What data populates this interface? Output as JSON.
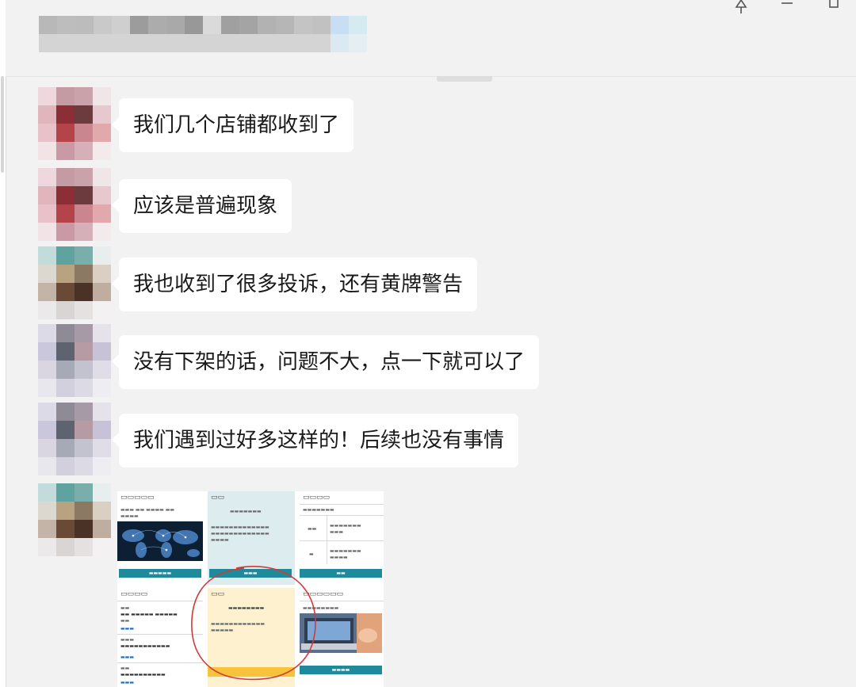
{
  "window": {
    "title": "",
    "controls": {
      "pin_icon": "pin-icon",
      "minimize_icon": "minimize-icon",
      "maximize_icon": "maximize-icon"
    }
  },
  "messages": [
    {
      "avatar": "avatar-red",
      "text": "我们几个店铺都收到了"
    },
    {
      "avatar": "avatar-red",
      "text": "应该是普遍现象"
    },
    {
      "avatar": "avatar-teal",
      "text": "我也收到了很多投诉，还有黄牌警告"
    },
    {
      "avatar": "avatar-lilac",
      "text": "没有下架的话，问题不大，点一下就可以了"
    },
    {
      "avatar": "avatar-lilac",
      "text": "我们遇到过好多这样的！后续也没有事情"
    }
  ],
  "image_message": {
    "avatar": "avatar-teal",
    "highlight_color": "#d23a3a",
    "accent_color": "#1f8a9b",
    "cells": [
      {
        "heading": "",
        "type": "world-map"
      },
      {
        "heading": "",
        "type": "light-panel"
      },
      {
        "heading": "",
        "type": "table"
      },
      {
        "heading": "",
        "type": "links"
      },
      {
        "heading": "",
        "type": "notice-yellow"
      },
      {
        "heading": "",
        "type": "laptop-photo"
      }
    ]
  }
}
